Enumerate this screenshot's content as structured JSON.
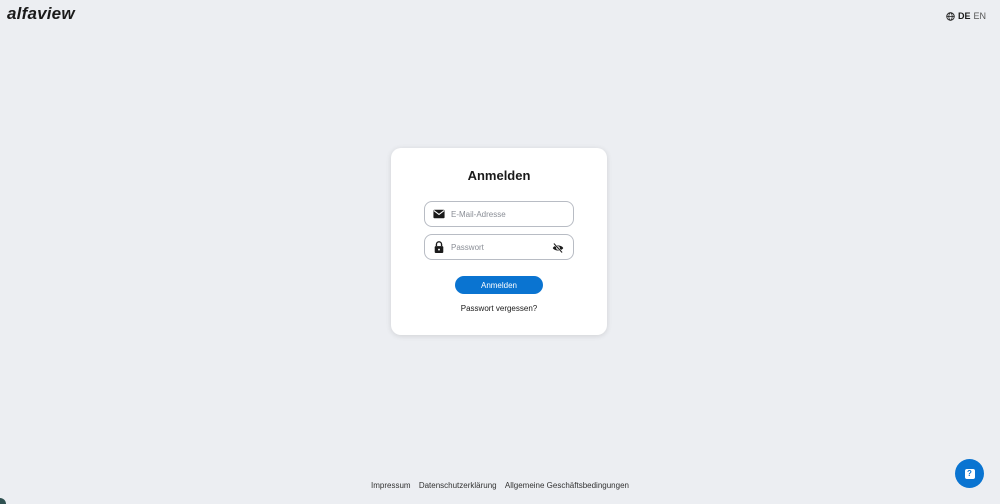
{
  "header": {
    "logo_text": "alfaview",
    "lang_current": "DE",
    "lang_other": "EN"
  },
  "login": {
    "title": "Anmelden",
    "email_placeholder": "E-Mail-Adresse",
    "password_placeholder": "Passwort",
    "submit_label": "Anmelden",
    "forgot_label": "Passwort vergessen?"
  },
  "footer": {
    "links": [
      "Impressum",
      "Datenschutzerklärung",
      "Allgemeine Geschäftsbedingungen"
    ]
  },
  "help": {
    "icon_glyph": "?"
  },
  "icons": {
    "globe": "globe-icon",
    "email": "envelope-icon",
    "lock": "lock-icon",
    "visibility": "eye-off-icon",
    "help": "help-icon"
  },
  "colors": {
    "background": "#eceef2",
    "accent": "#0a74d1",
    "card": "#ffffff"
  }
}
